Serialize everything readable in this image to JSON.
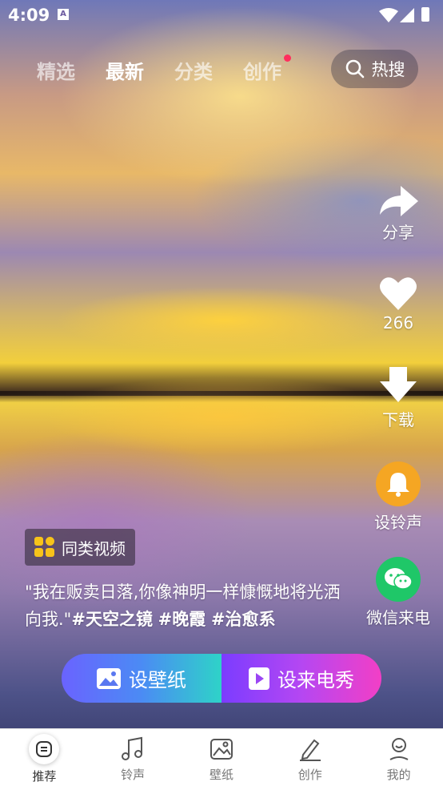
{
  "status_bar": {
    "time": "4:09",
    "notification_icon": "A"
  },
  "top_tabs": [
    {
      "label": "精选",
      "active": false
    },
    {
      "label": "最新",
      "active": true
    },
    {
      "label": "分类",
      "active": false
    },
    {
      "label": "创作",
      "active": false,
      "badge_dot": true
    }
  ],
  "search": {
    "label": "热搜",
    "icon": "search-icon"
  },
  "right_actions": {
    "share": {
      "label": "分享",
      "icon": "share-icon"
    },
    "like": {
      "label": "266",
      "icon": "heart-icon"
    },
    "download": {
      "label": "下载",
      "icon": "download-icon"
    },
    "ringtone": {
      "label": "设铃声",
      "icon": "bell-icon",
      "color": "#f5a623"
    },
    "wechat": {
      "label": "微信来电",
      "icon": "wechat-icon",
      "color": "#1fc768"
    }
  },
  "similar_videos": {
    "label": "同类视频",
    "icon": "grid-icon",
    "icon_color": "#f7c31a"
  },
  "caption": {
    "text": "\"我在贩卖日落,你像神明一样慷慨地将光洒向我.\"",
    "tags": [
      "#天空之镜",
      "#晚霞",
      "#治愈系"
    ]
  },
  "cta": {
    "wallpaper": {
      "label": "设壁纸",
      "icon": "image-icon"
    },
    "video_ringtone": {
      "label": "设来电秀",
      "icon": "play-icon"
    }
  },
  "bottom_nav": [
    {
      "label": "推荐",
      "icon": "home-icon",
      "active": true
    },
    {
      "label": "铃声",
      "icon": "music-icon",
      "active": false
    },
    {
      "label": "壁纸",
      "icon": "image-icon",
      "active": false
    },
    {
      "label": "创作",
      "icon": "pencil-icon",
      "active": false
    },
    {
      "label": "我的",
      "icon": "user-icon",
      "active": false
    }
  ]
}
